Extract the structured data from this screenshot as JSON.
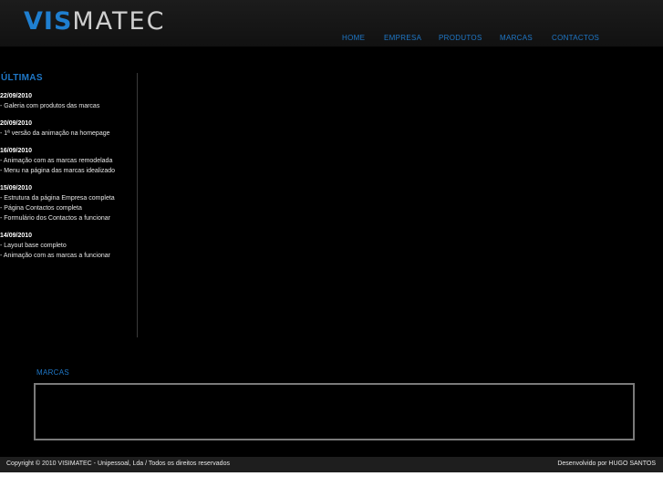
{
  "logo": {
    "part1": "VIS",
    "part2": "MATEC"
  },
  "nav": [
    "HOME",
    "EMPRESA",
    "PRODUTOS",
    "MARCAS",
    "CONTACTOS"
  ],
  "sidebar": {
    "title": "ÚLTIMAS",
    "entries": [
      {
        "date": "22/09/2010",
        "items": [
          "- Galeria com produtos das marcas"
        ]
      },
      {
        "date": "20/09/2010",
        "items": [
          "- 1ª versão da animação na homepage"
        ]
      },
      {
        "date": "16/09/2010",
        "items": [
          "- Animação com as marcas remodelada",
          "- Menu na página das marcas idealizado"
        ]
      },
      {
        "date": "15/09/2010",
        "items": [
          "- Estrutura da página Empresa completa",
          "- Página Contactos completa",
          "- Formulário dos Contactos a funcionar"
        ]
      },
      {
        "date": "14/09/2010",
        "items": [
          "- Layout base completo",
          "- Animação com as marcas a funcionar"
        ]
      }
    ]
  },
  "marcas": {
    "title": "MARCAS"
  },
  "footer": {
    "copyright": "Copyright © 2010 VISIMATEC - Unipessoal, Lda / Todos os direitos reservados",
    "credit": "Desenvolvido por HUGO SANTOS"
  },
  "colors": {
    "accent": "#1f78c8",
    "background": "#000000",
    "footer": "#1e1e1e"
  }
}
